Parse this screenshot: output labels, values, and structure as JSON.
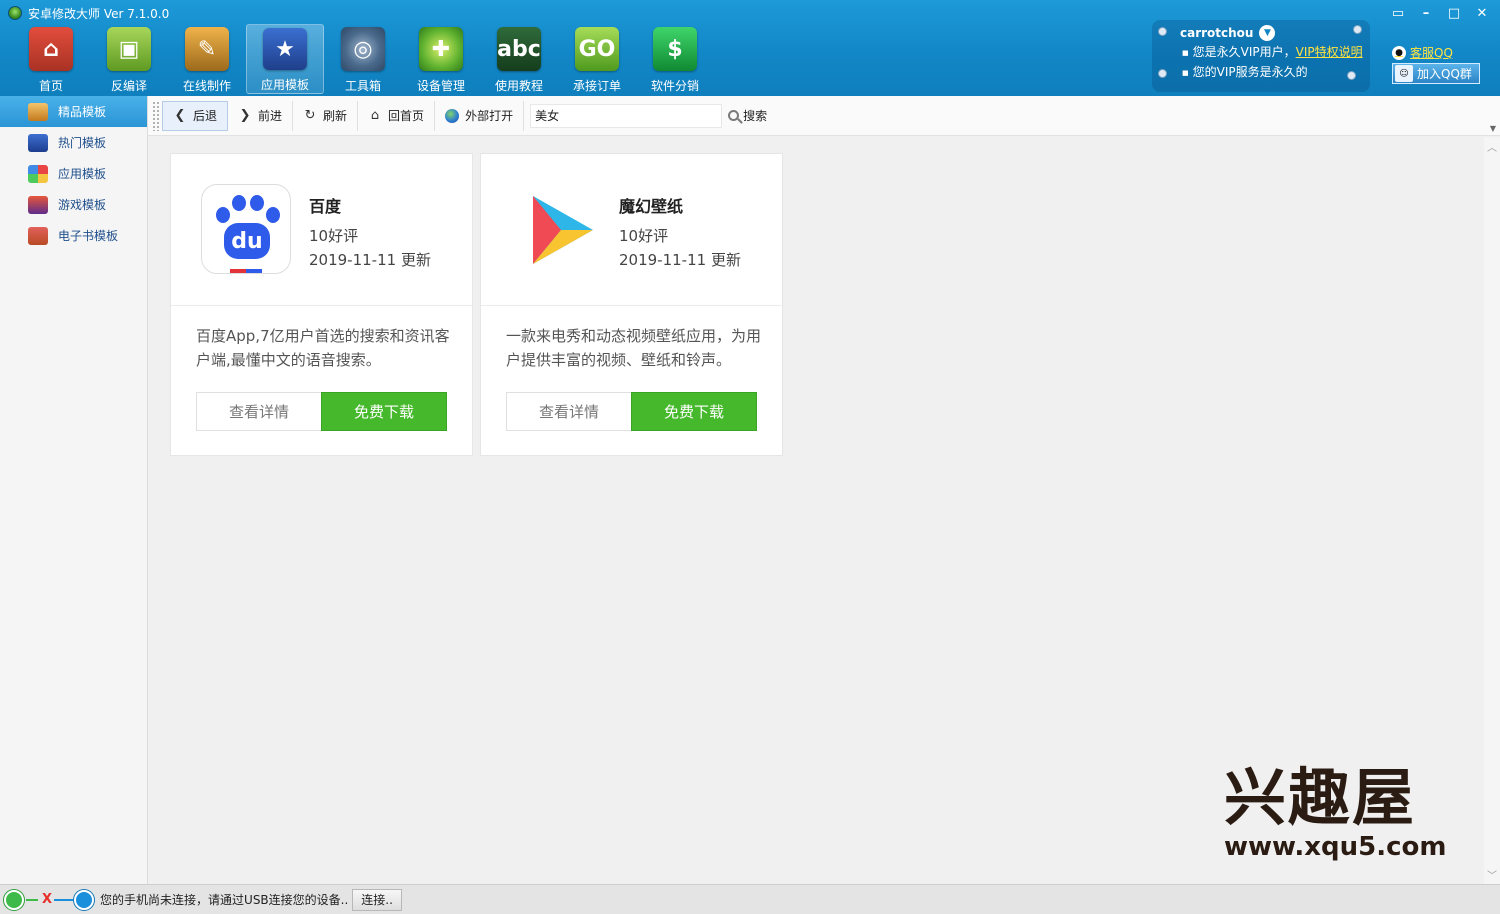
{
  "window": {
    "title": "安卓修改大师 Ver 7.1.0.0"
  },
  "toolbar": {
    "items": [
      {
        "label": "首页",
        "icon": "home-icon"
      },
      {
        "label": "反编译",
        "icon": "android-icon"
      },
      {
        "label": "在线制作",
        "icon": "toolbox-icon"
      },
      {
        "label": "应用模板",
        "icon": "template-star-icon"
      },
      {
        "label": "工具箱",
        "icon": "gear-lens-icon"
      },
      {
        "label": "设备管理",
        "icon": "radar-icon"
      },
      {
        "label": "使用教程",
        "icon": "blackboard-icon"
      },
      {
        "label": "承接订单",
        "icon": "shopping-bag-icon"
      },
      {
        "label": "软件分销",
        "icon": "dollar-icon"
      }
    ],
    "active_index": 3
  },
  "user": {
    "username": "carrotchou",
    "vip_line": "您是永久VIP用户，",
    "vip_link": "VIP特权说明",
    "service_line": "您的VIP服务是永久的"
  },
  "qq": {
    "service": "客服QQ",
    "group": "加入QQ群"
  },
  "sidebar": {
    "items": [
      {
        "label": "精品模板",
        "icon": "box-icon"
      },
      {
        "label": "热门模板",
        "icon": "star-icon"
      },
      {
        "label": "应用模板",
        "icon": "apps-icon"
      },
      {
        "label": "游戏模板",
        "icon": "game-icon"
      },
      {
        "label": "电子书模板",
        "icon": "book-icon"
      }
    ],
    "active_index": 0
  },
  "nav": {
    "back": "后退",
    "forward": "前进",
    "refresh": "刷新",
    "home": "回首页",
    "external": "外部打开",
    "search_value": "美女",
    "search_label": "搜索"
  },
  "cards": [
    {
      "name": "百度",
      "rating": "10好评",
      "updated": "2019-11-11 更新",
      "description": "百度App,7亿用户首选的搜索和资讯客户端,最懂中文的语音搜索。",
      "detail_label": "查看详情",
      "download_label": "免费下载",
      "icon": "baidu-paw-icon",
      "icon_text": "du"
    },
    {
      "name": "魔幻壁纸",
      "rating": "10好评",
      "updated": "2019-11-11 更新",
      "description": "一款来电秀和动态视频壁纸应用，为用户提供丰富的视频、壁纸和铃声。",
      "detail_label": "查看详情",
      "download_label": "免费下载",
      "icon": "play-triangle-icon"
    }
  ],
  "watermark": {
    "title": "兴趣屋",
    "url": "www.xqu5.com"
  },
  "status": {
    "message": "您的手机尚未连接，请通过USB连接您的设备..",
    "connect_label": "连接.."
  },
  "colors": {
    "header": "#1287c7",
    "accent_link": "#ffe341",
    "download_green": "#45b82b"
  }
}
